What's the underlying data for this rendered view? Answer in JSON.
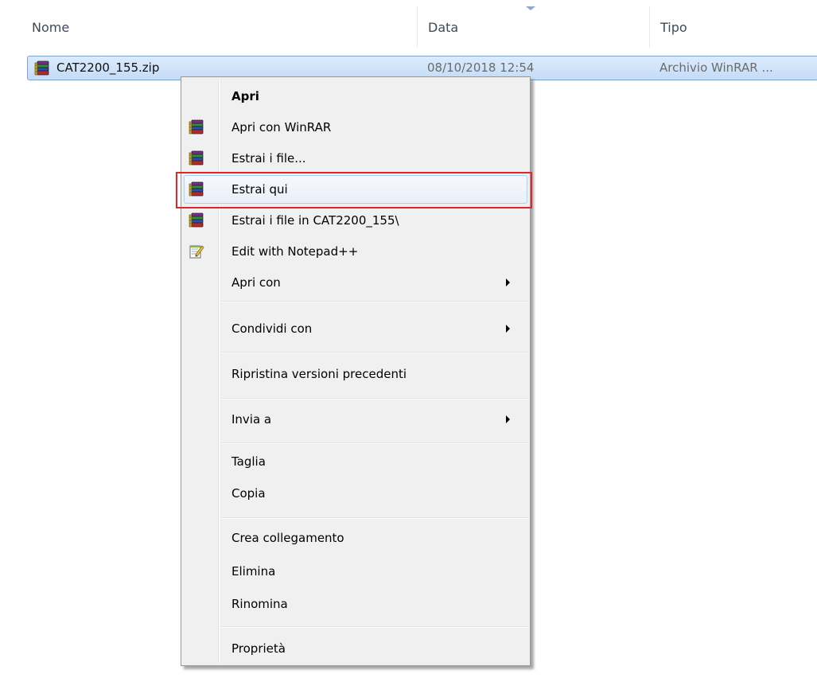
{
  "columns": {
    "name": "Nome",
    "date": "Data",
    "type": "Tipo"
  },
  "file": {
    "name": "CAT2200_155.zip",
    "date": "08/10/2018 12:54",
    "type": "Archivio WinRAR ...",
    "icon": "winrar-archive-icon"
  },
  "menu": {
    "open": "Apri",
    "open_with_winrar": "Apri con WinRAR",
    "extract_files": "Estrai i file...",
    "extract_here": "Estrai qui",
    "extract_to_folder": "Estrai i file in CAT2200_155\\",
    "edit_notepadpp": "Edit with Notepad++",
    "open_with": "Apri con",
    "share_with": "Condividi con",
    "restore_versions": "Ripristina versioni precedenti",
    "send_to": "Invia a",
    "cut": "Taglia",
    "copy": "Copia",
    "create_shortcut": "Crea collegamento",
    "delete": "Elimina",
    "rename": "Rinomina",
    "properties": "Proprietà"
  },
  "colors": {
    "highlight_border": "#e0252c",
    "selection_background": "#cce0f8",
    "menu_background": "#f0f0f0"
  }
}
